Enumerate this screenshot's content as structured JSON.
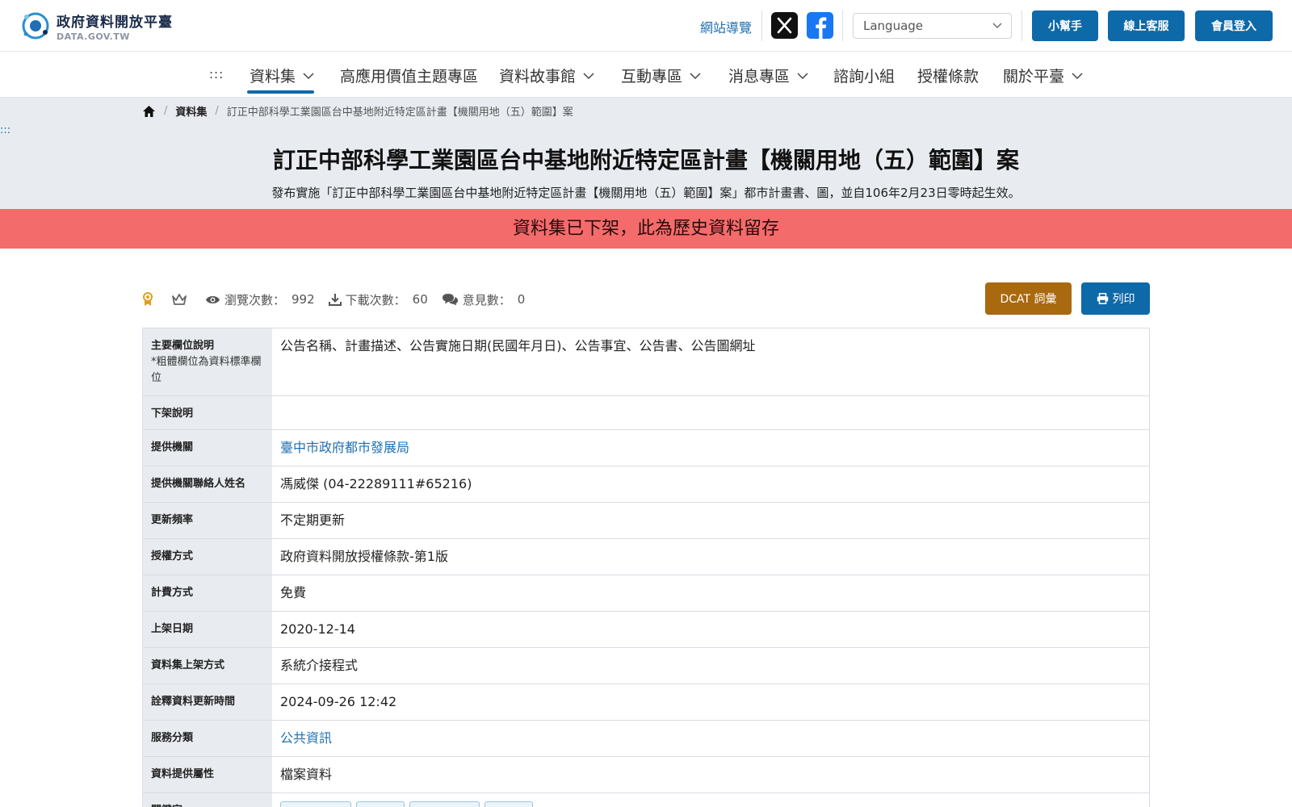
{
  "header": {
    "logo_title": "政府資料開放平臺",
    "logo_sub": "DATA.GOV.TW",
    "sitemap": "網站導覽",
    "language_placeholder": "Language",
    "buttons": {
      "helper": "小幫手",
      "online_service": "線上客服",
      "login": "會員登入"
    }
  },
  "nav": {
    "accessibility": ":::",
    "items": [
      "資料集",
      "高應用價值主題專區",
      "資料故事館",
      "互動專區",
      "消息專區",
      "諮詢小組",
      "授權條款",
      "關於平臺"
    ]
  },
  "breadcrumb": {
    "datasets": "資料集",
    "current": "訂正中部科學工業園區台中基地附近特定區計畫【機關用地（五）範圍】案"
  },
  "band_accessibility": ":::",
  "dataset": {
    "title": "訂正中部科學工業園區台中基地附近特定區計畫【機關用地（五）範圍】案",
    "description": "發布實施「訂正中部科學工業園區台中基地附近特定區計畫【機關用地（五）範圍】案」都市計畫書、圖，並自106年2月23日零時起生效。"
  },
  "alert": "資料集已下架，此為歷史資料留存",
  "stats": {
    "views_label": "瀏覽次數：",
    "views": "992",
    "downloads_label": "下載次數：",
    "downloads": "60",
    "comments_label": "意見數：",
    "comments": "0"
  },
  "actions": {
    "dcat": "DCAT 詞彙",
    "print": "列印"
  },
  "table": {
    "main_fields_label": "主要欄位說明",
    "main_fields_note": "*粗體欄位為資料標準欄位",
    "main_fields": "公告名稱、計畫描述、公告實施日期(民國年月日)、公告事宜、公告書、公告圖網址",
    "delisted_label": "下架說明",
    "delisted": "",
    "provider_label": "提供機關",
    "provider": "臺中市政府都市發展局",
    "contact_label": "提供機關聯絡人姓名",
    "contact": "馮威傑 (04-22289111#65216)",
    "frequency_label": "更新頻率",
    "frequency": "不定期更新",
    "license_label": "授權方式",
    "license": "政府資料開放授權條款-第1版",
    "fee_label": "計費方式",
    "fee": "免費",
    "published_label": "上架日期",
    "published": "2020-12-14",
    "publish_method_label": "資料集上架方式",
    "publish_method": "系統介接程式",
    "metadata_updated_label": "詮釋資料更新時間",
    "metadata_updated": "2024-09-26 12:42",
    "category_label": "服務分類",
    "category": "公共資訊",
    "attribute_label": "資料提供屬性",
    "attribute": "檔案資料",
    "keywords_label": "關鍵字"
  },
  "colors": {
    "primary": "#0e69a8",
    "alert": "#f36b6b",
    "dcat": "#a8690f",
    "band": "#e8ecf0",
    "link": "#1f6fb2"
  }
}
